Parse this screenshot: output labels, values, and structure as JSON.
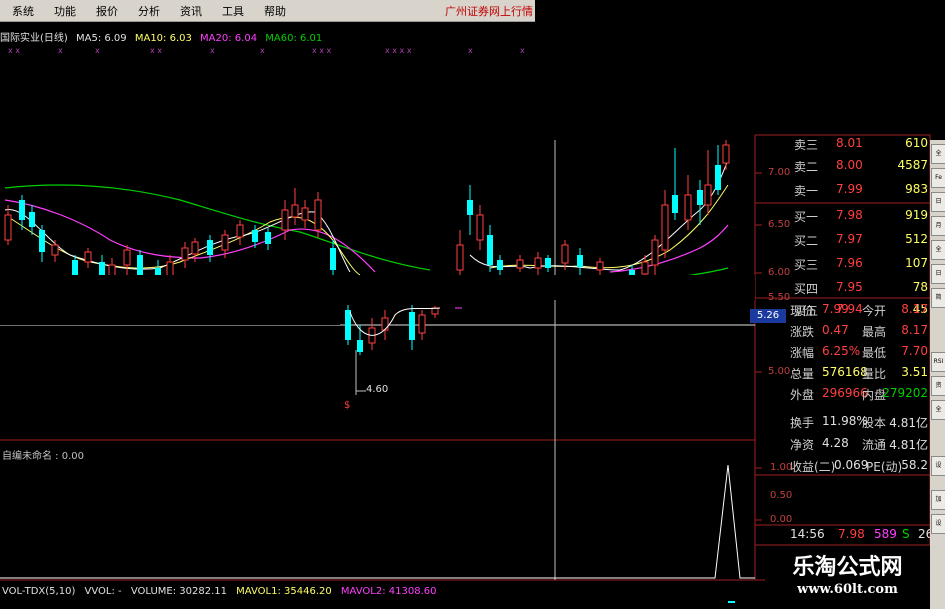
{
  "menu": [
    "系统",
    "功能",
    "报价",
    "分析",
    "资讯",
    "工具",
    "帮助"
  ],
  "brokerage": "广州证券网上行情",
  "chart_header": {
    "stock": "国际实业(日线)",
    "ma5": "MA5: 6.09",
    "ma10": "MA10: 6.03",
    "ma20": "MA20: 6.04",
    "ma60": "MA60: 6.01"
  },
  "colors": {
    "ma5": "#ffffff",
    "ma10": "#ffff66",
    "ma20": "#ff40ff",
    "ma60": "#00d000",
    "up": "#ff4040",
    "down": "#00ffff",
    "up_candle": "#000000"
  },
  "price_axis": [
    "7.00",
    "6.50",
    "6.00",
    "5.50",
    "5.00"
  ],
  "price_tag": "5.26",
  "low_marker": "4.60",
  "order_book": {
    "asks": [
      {
        "label": "卖三",
        "price": "8.01",
        "volume": "610"
      },
      {
        "label": "卖二",
        "price": "8.00",
        "volume": "4587"
      },
      {
        "label": "卖一",
        "price": "7.99",
        "volume": "983"
      }
    ],
    "bids": [
      {
        "label": "买一",
        "price": "7.98",
        "volume": "919"
      },
      {
        "label": "买二",
        "price": "7.97",
        "volume": "512"
      },
      {
        "label": "买三",
        "price": "7.96",
        "volume": "107"
      },
      {
        "label": "买四",
        "price": "7.95",
        "volume": "78"
      },
      {
        "label": "买五",
        "price": "7.94",
        "volume": "45"
      }
    ]
  },
  "quote": [
    {
      "l1": "现价",
      "v1": "7.99",
      "l2": "今开",
      "v2": "8.17"
    },
    {
      "l1": "涨跌",
      "v1": "0.47",
      "l2": "最高",
      "v2": "8.17"
    },
    {
      "l1": "涨幅",
      "v1": "6.25%",
      "l2": "最低",
      "v2": "7.70"
    },
    {
      "l1": "总量",
      "v1": "576168",
      "l2": "量比",
      "v2": "3.51"
    },
    {
      "l1": "外盘",
      "v1": "296966",
      "l2": "内盘",
      "v2": "279202"
    },
    {
      "l1": "换手",
      "v1": "11.98%",
      "l2": "股本",
      "v2": "4.81亿"
    },
    {
      "l1": "净资",
      "v1": "4.28",
      "l2": "流通",
      "v2": "4.81亿"
    },
    {
      "l1": "收益(二)",
      "v1": "0.069",
      "l2": "PE(动)",
      "v2": "58.2"
    }
  ],
  "tick": {
    "time": "14:56",
    "price": "7.98",
    "volume": "589",
    "side": "S",
    "count": "26"
  },
  "indicator": {
    "label": "自编未命名 : 0.00",
    "axis": [
      "1.00",
      "0.50",
      "0.00"
    ]
  },
  "volume_bar": {
    "name": "VOL-TDX(5,10)",
    "vvol": "VVOL: -",
    "volume": "VOLUME: 30282.11",
    "mavol1": "MAVOL1: 35446.20",
    "mavol2": "MAVOL2: 41308.60"
  },
  "toolbar": [
    "全",
    "Fe",
    "日",
    "月",
    "全",
    "日",
    "简",
    "RSI",
    "资",
    "全",
    "设",
    "加",
    "设"
  ],
  "watermark": {
    "title": "乐淘公式网",
    "url": "www.60lt.com"
  }
}
